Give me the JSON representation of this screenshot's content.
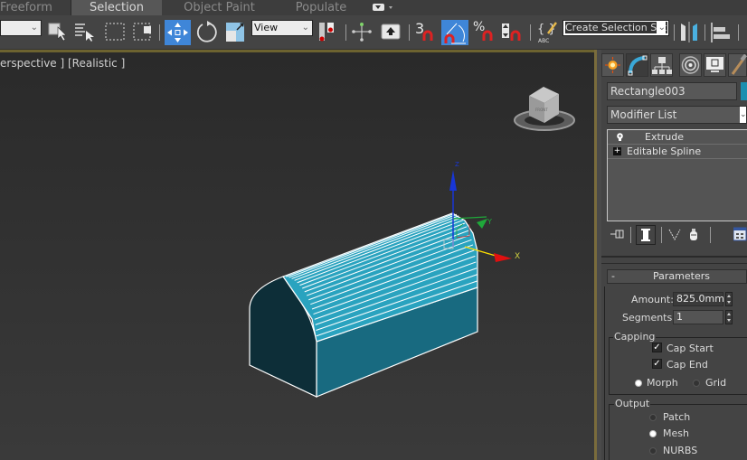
{
  "ribbon": {
    "tabs": [
      {
        "label": "Freeform",
        "active": false
      },
      {
        "label": "Selection",
        "active": true
      },
      {
        "label": "Object Paint",
        "active": false
      },
      {
        "label": "Populate",
        "active": false
      }
    ],
    "overflow_icon": "ribbon-options-icon"
  },
  "toolbar": {
    "selection_filter_value": "",
    "reference_coord_value": "View",
    "named_selection_placeholder": "Create Selection Set",
    "snap_angle_label": "3",
    "tools": [
      "select-object-icon",
      "select-by-name-icon",
      "rectangular-selection-icon",
      "window-crossing-icon",
      "select-and-move-icon",
      "select-and-rotate-icon",
      "select-and-scale-icon",
      "select-manipulate-icon",
      "use-pivot-center-icon",
      "keyboard-shortcut-override-icon",
      "snaps-toggle-icon",
      "angle-snap-icon",
      "percent-snap-icon",
      "spinner-snap-icon",
      "edit-named-selection-icon",
      "mirror-icon",
      "align-icon"
    ]
  },
  "viewport": {
    "label": "erspective ] [Realistic ]",
    "colors": {
      "object_top": "#2aa3bf",
      "object_side": "#186a80",
      "object_cap": "#0d2e38",
      "axis_x": "#e01010",
      "axis_y": "#1fa83a",
      "axis_z": "#1836d6",
      "frame_accent": "#6d6330"
    },
    "gizmo_labels": {
      "x": "X",
      "y": "Y",
      "z": "Z"
    },
    "viewcube_label": "FRONT"
  },
  "command_panel": {
    "tabs": [
      "create-icon",
      "modify-icon",
      "hierarchy-icon",
      "motion-icon",
      "display-icon",
      "utilities-icon"
    ],
    "active_tab": "modify-icon",
    "object_name": "Rectangle003",
    "object_color": "#1d8fb0",
    "modifier_list_label": "Modifier List",
    "stack": [
      {
        "label": "Extrude",
        "icon": "lightbulb-icon"
      },
      {
        "label": "Editable Spline",
        "icon": "expand-plus-icon"
      }
    ],
    "stack_tools": [
      "pin-stack-icon",
      "show-end-result-icon",
      "make-unique-icon",
      "remove-modifier-icon",
      "configure-modifier-sets-icon"
    ],
    "parameters": {
      "title": "Parameters",
      "collapse_symbol": "-",
      "amount_label": "Amount:",
      "amount_value": "825.0mm",
      "segments_label": "Segments:",
      "segments_value": "1",
      "capping": {
        "title": "Capping",
        "cap_start_label": "Cap Start",
        "cap_start_checked": true,
        "cap_end_label": "Cap End",
        "cap_end_checked": true,
        "morph_label": "Morph",
        "grid_label": "Grid",
        "selected": "Morph"
      },
      "output": {
        "title": "Output",
        "options": [
          "Patch",
          "Mesh",
          "NURBS"
        ],
        "selected": "Mesh"
      }
    }
  }
}
